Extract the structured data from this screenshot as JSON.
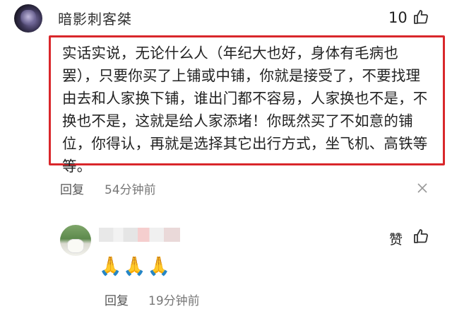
{
  "comments": [
    {
      "username": "暗影刺客桀",
      "like_count": "10",
      "text": "实话实说，无论什么人（年纪大也好，身体有毛病也罢），只要你买了上铺或中铺，你就是接受了，不要找理由去和人家换下铺，谁出门都不容易，人家换也不是，不换也不是，这就是给人家添堵！你既然买了不如意的铺位，你得认，再就是选择其它出行方式，坐飞机、高铁等等。",
      "reply_label": "回复",
      "time": "54分钟前",
      "highlight_color": "#d9272b"
    },
    {
      "like_label": "赞",
      "emojis": "🙏🙏🙏",
      "reply_label": "回复",
      "time": "19分钟前"
    }
  ],
  "icons": {
    "like": "thumbs-up-icon",
    "close": "close-icon"
  }
}
